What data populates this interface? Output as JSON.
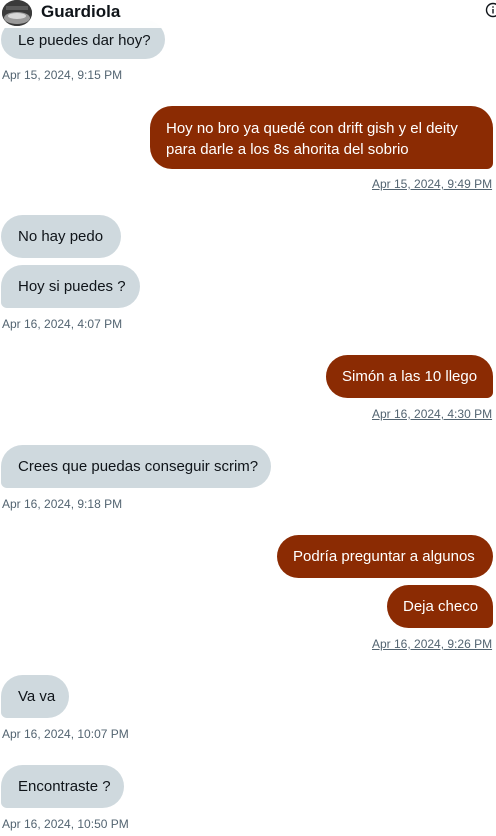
{
  "header": {
    "contact_name": "Guardiola",
    "avatar_icon": "avatar-image",
    "info_icon": "info-icon"
  },
  "colors": {
    "incoming_bubble": "#cfd9de",
    "outgoing_bubble": "#8b2b03",
    "timestamp": "#536471"
  },
  "messages": [
    {
      "dir": "in",
      "text": "Le puedes dar hoy?"
    },
    {
      "dir": "in",
      "ts": "Apr 15, 2024, 9:15 PM"
    },
    {
      "dir": "out",
      "text_lines": [
        "Hoy no bro ya quedé con drift gish y el deity",
        "para darle a los 8s ahorita del sobrio"
      ]
    },
    {
      "dir": "out",
      "ts": "Apr 15, 2024, 9:49 PM"
    },
    {
      "dir": "in",
      "text": "No hay pedo"
    },
    {
      "dir": "in",
      "text": "Hoy si puedes ?"
    },
    {
      "dir": "in",
      "ts": "Apr 16, 2024, 4:07 PM"
    },
    {
      "dir": "out",
      "text": "Simón a las 10 llego"
    },
    {
      "dir": "out",
      "ts": "Apr 16, 2024, 4:30 PM"
    },
    {
      "dir": "in",
      "text": "Crees que puedas conseguir scrim?"
    },
    {
      "dir": "in",
      "ts": "Apr 16, 2024, 9:18 PM"
    },
    {
      "dir": "out",
      "text": "Podría preguntar a algunos"
    },
    {
      "dir": "out",
      "text": "Deja checo"
    },
    {
      "dir": "out",
      "ts": "Apr 16, 2024, 9:26 PM"
    },
    {
      "dir": "in",
      "text": "Va va"
    },
    {
      "dir": "in",
      "ts": "Apr 16, 2024, 10:07 PM"
    },
    {
      "dir": "in",
      "text": "Encontraste ?"
    },
    {
      "dir": "in",
      "ts": "Apr 16, 2024, 10:50 PM"
    }
  ]
}
